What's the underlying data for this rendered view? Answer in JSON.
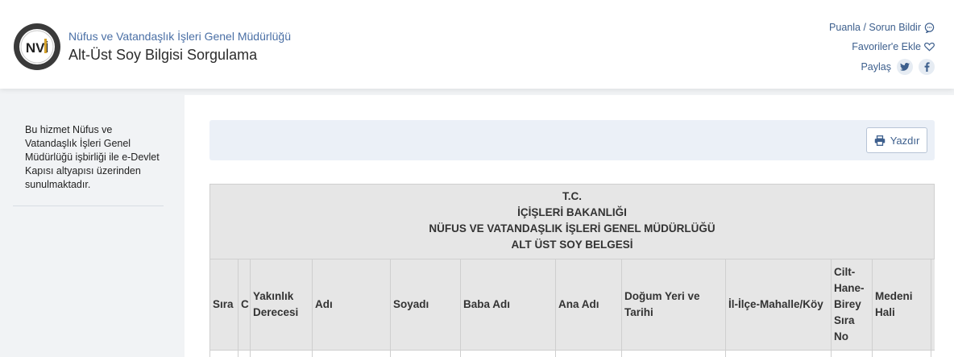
{
  "header": {
    "org_name": "Nüfus ve Vatandaşlık İşleri Genel Müdürlüğü",
    "service_title": "Alt-Üst Soy Bilgisi Sorgulama",
    "logo_text": "NVİ",
    "links": {
      "rate_report": "Puanla / Sorun Bildir",
      "add_favorites": "Favoriler'e Ekle",
      "share": "Paylaş"
    }
  },
  "sidebar": {
    "info": "Bu hizmet Nüfus ve Vatandaşlık İşleri Genel Müdürlüğü işbirliği ile e-Devlet Kapısı altyapısı üzerinden sunulmaktadır."
  },
  "toolbar": {
    "print_label": "Yazdır"
  },
  "document": {
    "heading_lines": [
      "T.C.",
      "İÇİŞLERİ BAKANLIĞI",
      "NÜFUS VE VATANDAŞLIK İŞLERİ GENEL MÜDÜRLÜĞÜ",
      "ALT ÜST SOY BELGESİ"
    ],
    "columns": [
      "Sıra",
      "C",
      "Yakınlık Derecesi",
      "Adı",
      "Soyadı",
      "Baba Adı",
      "Ana Adı",
      "Doğum Yeri ve Tarihi",
      "İl-İlçe-Mahalle/Köy",
      "Cilt-Hane-Birey Sıra No",
      "Medeni Hali",
      ""
    ]
  },
  "colors": {
    "accent": "#3d5f8d",
    "header_bg": "#ffffff",
    "page_bg": "#f1f3f5",
    "table_header_bg": "#e6e6e6"
  }
}
